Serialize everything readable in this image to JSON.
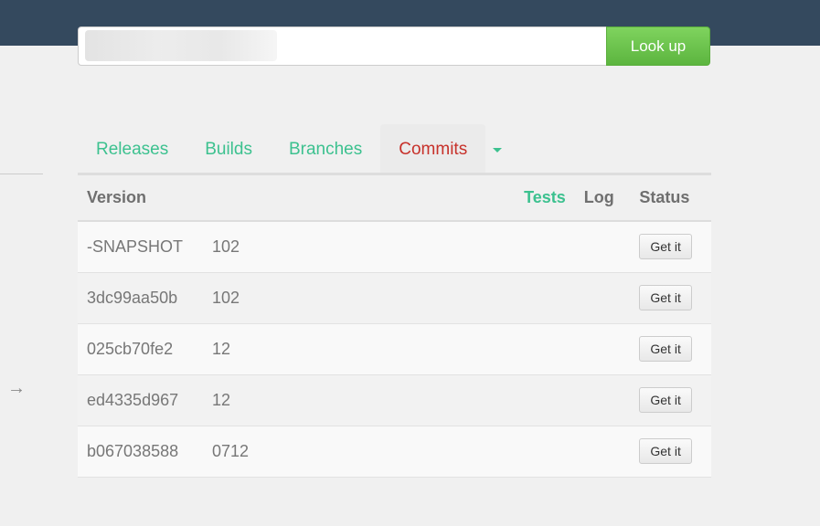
{
  "search": {
    "value": "",
    "button": "Look up"
  },
  "tabs": [
    {
      "label": "Releases"
    },
    {
      "label": "Builds"
    },
    {
      "label": "Branches"
    },
    {
      "label": "Commits",
      "active": true
    }
  ],
  "table": {
    "headers": {
      "version": "Version",
      "tests": "Tests",
      "log": "Log",
      "status": "Status"
    },
    "rows": [
      {
        "version": "-SNAPSHOT",
        "num": "102",
        "action": "Get it"
      },
      {
        "version": "3dc99aa50b",
        "num": "102",
        "action": "Get it"
      },
      {
        "version": "025cb70fe2",
        "num": "12",
        "action": "Get it"
      },
      {
        "version": "ed4335d967",
        "num": "12",
        "action": "Get it"
      },
      {
        "version": "b067038588",
        "num": "0712",
        "action": "Get it"
      }
    ]
  },
  "side": {
    "arrow": "→"
  }
}
